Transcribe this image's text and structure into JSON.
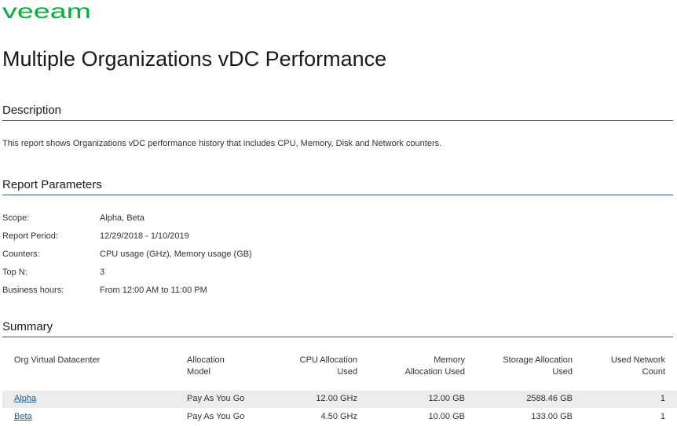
{
  "brand": {
    "name": "VEEAM",
    "color": "#00b336"
  },
  "title": "Multiple Organizations vDC Performance",
  "description": {
    "heading": "Description",
    "text": "This report shows Organizations vDC performance history that includes CPU, Memory, Disk and Network counters."
  },
  "parameters": {
    "heading": "Report Parameters",
    "rows": [
      {
        "label": "Scope:",
        "value": "Alpha, Beta"
      },
      {
        "label": "Report Period:",
        "value": "12/29/2018 - 1/10/2019"
      },
      {
        "label": "Counters:",
        "value": "CPU usage (GHz), Memory usage (GB)"
      },
      {
        "label": "Top N:",
        "value": "3"
      },
      {
        "label": "Business hours:",
        "value": "From 12:00 AM to 11:00 PM"
      }
    ]
  },
  "summary": {
    "heading": "Summary",
    "columns": [
      {
        "line1": "Org Virtual Datacenter",
        "line2": ""
      },
      {
        "line1": "Allocation",
        "line2": "Model"
      },
      {
        "line1": "CPU Allocation",
        "line2": "Used"
      },
      {
        "line1": "Memory",
        "line2": "Allocation Used"
      },
      {
        "line1": "Storage Allocation",
        "line2": "Used"
      },
      {
        "line1": "Used Network",
        "line2": "Count"
      }
    ],
    "rows": [
      {
        "name": "Alpha",
        "model": "Pay As You Go",
        "cpu": "12.00 GHz",
        "memory": "12.00 GB",
        "storage": "2588.46 GB",
        "network": "1"
      },
      {
        "name": "Beta",
        "model": "Pay As You Go",
        "cpu": "4.50 GHz",
        "memory": "10.00 GB",
        "storage": "133.00 GB",
        "network": "1"
      }
    ]
  }
}
